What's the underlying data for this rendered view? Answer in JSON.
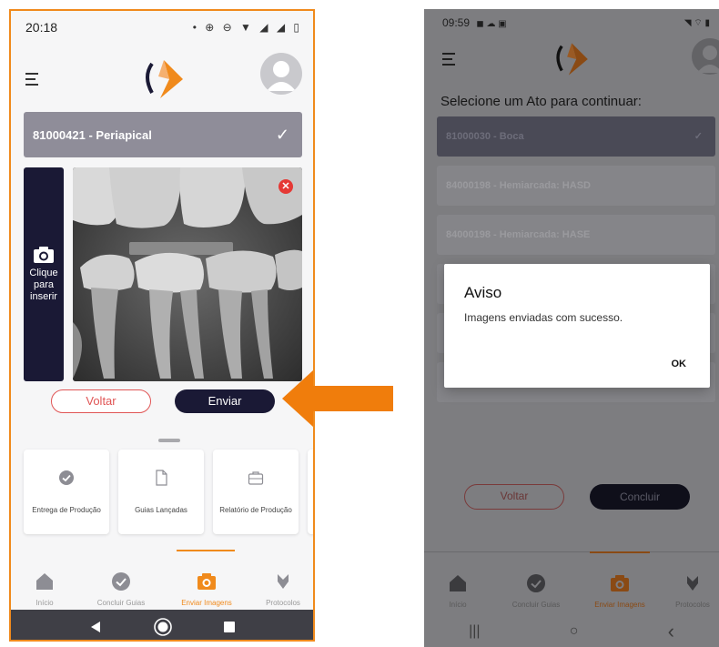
{
  "left_screen": {
    "status_bar": {
      "time": "20:18",
      "icons": "• ⊕ ⊖ ▼ ◢ ◢ ▯"
    },
    "selected_procedure": {
      "label": "81000421 - Periapical",
      "check": "✓"
    },
    "insert_panel": {
      "label": "Clique para inserir"
    },
    "remove_icon": "✕",
    "buttons": {
      "back": "Voltar",
      "send": "Enviar"
    },
    "cards": [
      {
        "label": "Entrega de Produção",
        "icon": "check-circle-icon"
      },
      {
        "label": "Guias Lançadas",
        "icon": "document-icon"
      },
      {
        "label": "Relatório de Produção",
        "icon": "briefcase-icon"
      }
    ],
    "tabs": [
      {
        "label": "Início",
        "icon": "home-icon"
      },
      {
        "label": "Concluir Guias",
        "icon": "check-circle-icon"
      },
      {
        "label": "Enviar Imagens",
        "icon": "camera-icon",
        "active": true
      },
      {
        "label": "Protocolos",
        "icon": "protocol-icon"
      }
    ]
  },
  "right_screen": {
    "status_bar": {
      "time": "09:59",
      "icons": "◼ ☁ ▣",
      "right_icons": "◥ ⌔ ▮"
    },
    "title": "Selecione um Ato para continuar:",
    "options": [
      {
        "label": "81000030 - Boca",
        "selected": true,
        "check": "✓"
      },
      {
        "label": "84000198 - Hemiarcada: HASD"
      },
      {
        "label": "84000198 - Hemiarcada: HASE"
      }
    ],
    "buttons": {
      "back": "Voltar",
      "conclude": "Concluir"
    },
    "dialog": {
      "title": "Aviso",
      "message": "Imagens enviadas com sucesso.",
      "ok": "OK"
    },
    "tabs": [
      {
        "label": "Início",
        "icon": "home-icon"
      },
      {
        "label": "Concluir Guias",
        "icon": "check-circle-icon"
      },
      {
        "label": "Enviar Imagens",
        "icon": "camera-icon",
        "active": true
      },
      {
        "label": "Protocolos",
        "icon": "protocol-icon"
      }
    ],
    "nav": {
      "recents": "|||",
      "home": "○",
      "back": "‹"
    }
  },
  "colors": {
    "accent": "#f08a1c",
    "navy": "#1a1935",
    "danger": "#e05555"
  }
}
